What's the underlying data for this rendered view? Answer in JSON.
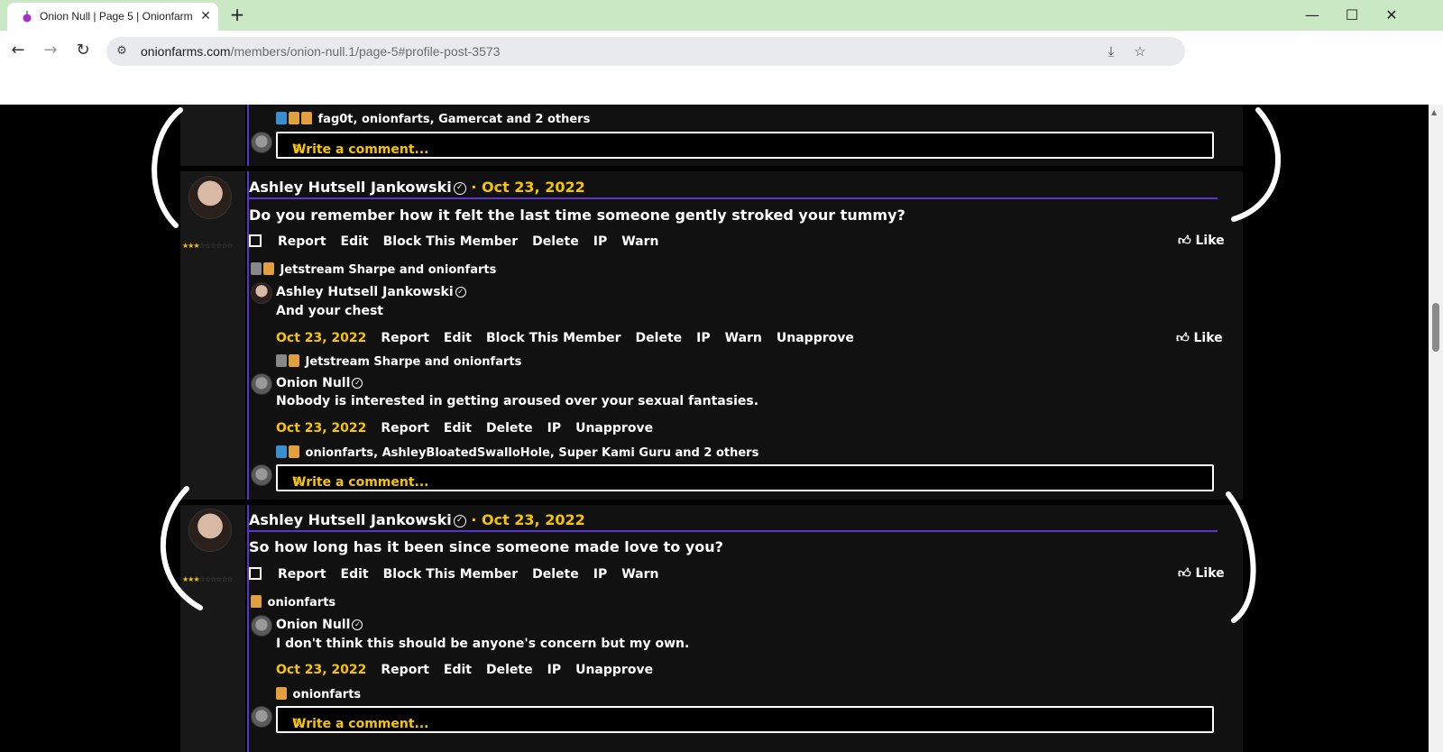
{
  "browser": {
    "tab_title": "Onion Null | Page 5 | Onionfarm",
    "tab_close": "✕",
    "new_tab": "+",
    "url_host": "onionfarms.com",
    "url_path": "/members/onion-null.1/page-5#profile-post-3573",
    "window_minimize": "—",
    "window_maximize": "☐",
    "window_close": "✕"
  },
  "top_fragment": {
    "likers": "fag0t, onionfarts, Gamercat and 2 others",
    "write_comment": "Write a comment..."
  },
  "posts": [
    {
      "author": "Ashley Hutsell Jankowski",
      "date": "· Oct 23, 2022",
      "text": "Do you remember how it felt the last time someone gently stroked your tummy?",
      "actions": [
        "Report",
        "Edit",
        "Block This Member",
        "Delete",
        "IP",
        "Warn"
      ],
      "like": "Like",
      "likers": "Jetstream Sharpe and onionfarts",
      "comments": [
        {
          "author": "Ashley Hutsell Jankowski",
          "text": "And your chest",
          "date": "Oct 23, 2022",
          "actions": [
            "Report",
            "Edit",
            "Block This Member",
            "Delete",
            "IP",
            "Warn",
            "Unapprove"
          ],
          "like": "Like",
          "likers": "Jetstream Sharpe and onionfarts"
        },
        {
          "author": "Onion Null",
          "text": "Nobody is interested in getting aroused over your sexual fantasies.",
          "date": "Oct 23, 2022",
          "actions": [
            "Report",
            "Edit",
            "Delete",
            "IP",
            "Unapprove"
          ],
          "likers": "onionfarts, AshleyBloatedSwalloHole, Super Kami Guru and 2 others"
        }
      ],
      "write_comment": "Write a comment..."
    },
    {
      "author": "Ashley Hutsell Jankowski",
      "date": "· Oct 23, 2022",
      "text": "So how long has it been since someone made love to you?",
      "actions": [
        "Report",
        "Edit",
        "Block This Member",
        "Delete",
        "IP",
        "Warn"
      ],
      "like": "Like",
      "likers": "onionfarts",
      "comments": [
        {
          "author": "Onion Null",
          "text": "I don't think this should be anyone's concern but my own.",
          "date": "Oct 23, 2022",
          "actions": [
            "Report",
            "Edit",
            "Delete",
            "IP",
            "Unapprove"
          ],
          "likers": "onionfarts"
        }
      ],
      "write_comment": "Write a comment..."
    }
  ],
  "colors": {
    "accent_purple": "#5a35c9",
    "date_yellow": "#f6c500",
    "tabbar_green": "#cbe8c5"
  },
  "icons": {
    "like": "thumbs-up-icon",
    "verified": "verified-check-icon",
    "pencil": "pencil-icon"
  }
}
